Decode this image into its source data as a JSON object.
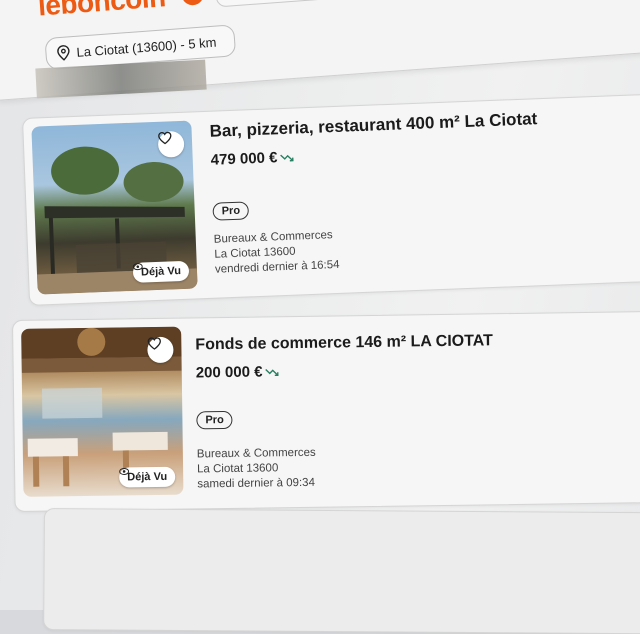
{
  "header": {
    "logo": "leboncoin",
    "location": "La Ciotat (13600) - 5 km"
  },
  "listings": [
    {
      "title": "Bar, pizzeria, restaurant 400 m² La Ciotat",
      "price": "479 000 €",
      "badge": "Pro",
      "category": "Bureaux & Commerces",
      "city": "La Ciotat 13600",
      "date": "vendredi dernier à 16:54",
      "seen_label": "Déjà Vu"
    },
    {
      "title": "Fonds de commerce 146 m² LA CIOTAT",
      "price": "200 000 €",
      "badge": "Pro",
      "category": "Bureaux & Commerces",
      "city": "La Ciotat 13600",
      "date": "samedi dernier à 09:34",
      "seen_label": "Déjà Vu"
    }
  ],
  "colors": {
    "brand": "#ec5a13",
    "price_trend": "#2a7f62"
  }
}
